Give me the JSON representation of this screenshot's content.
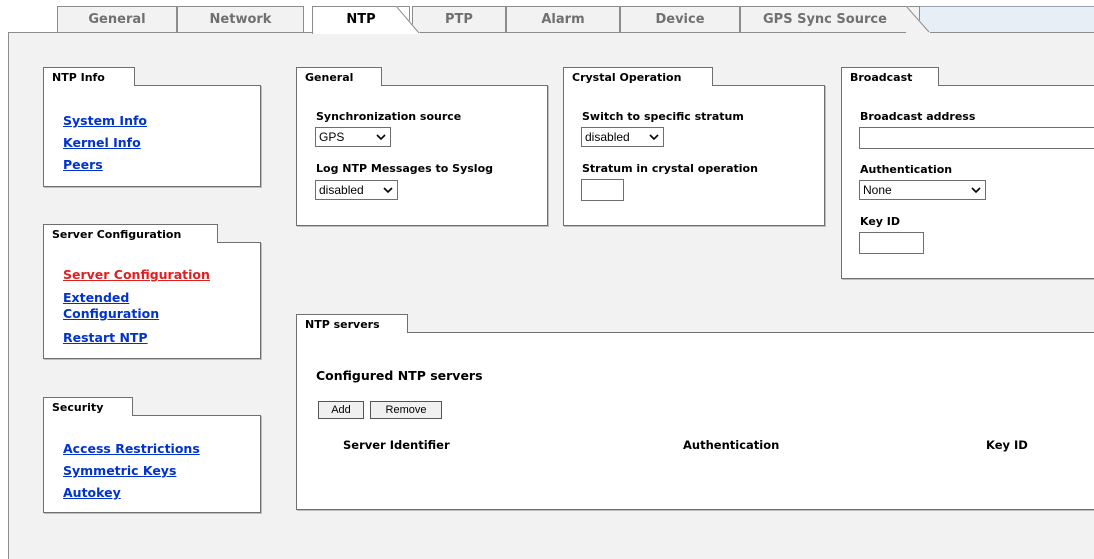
{
  "tabs": [
    {
      "label": "General"
    },
    {
      "label": "Network"
    },
    {
      "label": "NTP",
      "active": true
    },
    {
      "label": "PTP"
    },
    {
      "label": "Alarm"
    },
    {
      "label": "Device"
    },
    {
      "label": "GPS Sync Source"
    }
  ],
  "ntp_info": {
    "title": "NTP Info",
    "links": [
      "System Info",
      "Kernel Info",
      "Peers"
    ]
  },
  "server_config": {
    "title": "Server Configuration",
    "links": [
      "Server Configuration",
      "Extended Configuration",
      "Restart NTP"
    ],
    "current_link": "Server Configuration"
  },
  "security": {
    "title": "Security",
    "links": [
      "Access Restrictions",
      "Symmetric Keys",
      "Autokey"
    ]
  },
  "general": {
    "title": "General",
    "sync_source_label": "Synchronization source",
    "sync_source_value": "GPS",
    "log_label": "Log NTP Messages to Syslog",
    "log_value": "disabled"
  },
  "crystal": {
    "title": "Crystal Operation",
    "switch_label": "Switch to specific stratum",
    "switch_value": "disabled",
    "stratum_label": "Stratum in crystal operation",
    "stratum_value": ""
  },
  "broadcast": {
    "title": "Broadcast",
    "address_label": "Broadcast address",
    "address_value": "",
    "auth_label": "Authentication",
    "auth_value": "None",
    "keyid_label": "Key ID",
    "keyid_value": ""
  },
  "ntp_servers": {
    "title": "NTP servers",
    "heading": "Configured NTP servers",
    "add_label": "Add",
    "remove_label": "Remove",
    "columns": [
      "Server Identifier",
      "Authentication",
      "Key ID"
    ]
  },
  "colors": {
    "link": "#0033cc",
    "current_link": "#e02020",
    "content_bg": "#f2f2f2"
  }
}
